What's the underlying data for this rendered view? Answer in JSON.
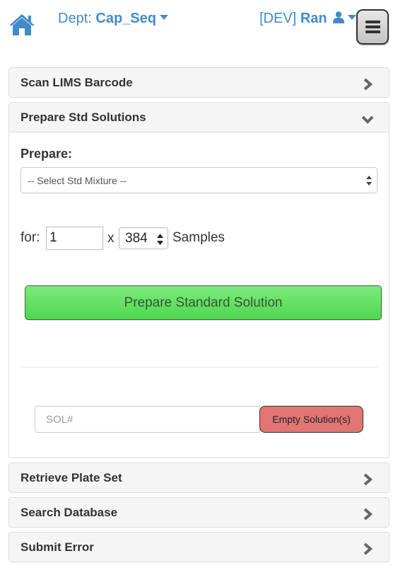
{
  "header": {
    "dept_prefix": "Dept:",
    "dept_name": "Cap_Seq",
    "env": "[DEV]",
    "user_name": "Ran"
  },
  "panels": [
    {
      "title": "Scan LIMS Barcode",
      "state": "collapsed"
    },
    {
      "title": "Prepare Std Solutions",
      "state": "expanded"
    },
    {
      "title": "Retrieve Plate Set",
      "state": "collapsed"
    },
    {
      "title": "Search Database",
      "state": "collapsed"
    },
    {
      "title": "Submit Error",
      "state": "collapsed"
    }
  ],
  "prepare": {
    "label": "Prepare:",
    "mixture_selected": "-- Select Std Mixture --",
    "for_label": "for:",
    "quantity": "1",
    "times": "x",
    "plate_size": "384",
    "samples_label": "Samples",
    "submit_label": "Prepare Standard Solution",
    "sol_placeholder": "SOL#",
    "empty_label": "Empty Solution(s)"
  },
  "colors": {
    "link_blue": "#428bca",
    "green_button": "#5cd65c",
    "red_button": "#e37575",
    "panel_heading_bg": "#f5f5f5"
  },
  "icons": [
    "home-icon",
    "user-icon",
    "hamburger-icon",
    "chevron-right-icon",
    "chevron-down-icon"
  ]
}
